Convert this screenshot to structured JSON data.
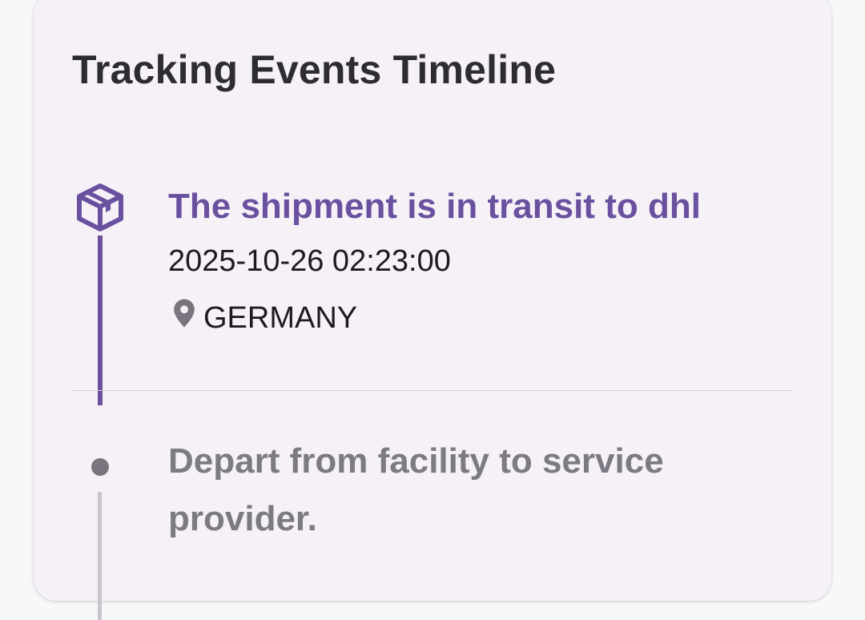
{
  "card": {
    "title": "Tracking Events Timeline"
  },
  "events": [
    {
      "title": "The shipment is in transit to dhl",
      "time": "2025-10-26 02:23:00",
      "location": "GERMANY",
      "icon": "package-icon",
      "status": "current"
    },
    {
      "title": "Depart from facility to service provider.",
      "status": "past",
      "icon": "timeline-dot"
    }
  ],
  "colors": {
    "accent": "#6a51a0",
    "muted": "#7c7a82",
    "card_bg": "#f6f1f7",
    "text": "#1d1b20"
  }
}
